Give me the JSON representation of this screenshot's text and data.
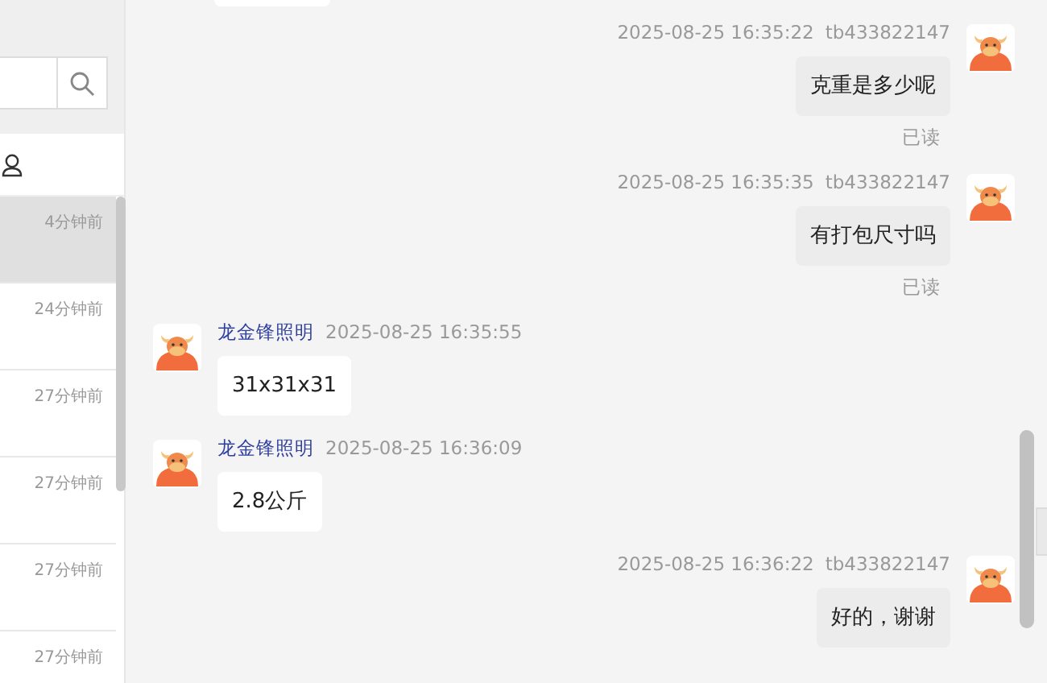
{
  "sidebar": {
    "conversations": [
      {
        "time": "4分钟前",
        "selected": true
      },
      {
        "time": "24分钟前",
        "selected": false
      },
      {
        "time": "27分钟前",
        "selected": false
      },
      {
        "time": "27分钟前",
        "selected": false
      },
      {
        "time": "27分钟前",
        "selected": false
      },
      {
        "time": "27分钟前",
        "selected": false
      }
    ]
  },
  "chat": {
    "messages": [
      {
        "kind": "sent",
        "time": "2025-08-25 16:35:22",
        "sender": "tb433822147",
        "text": "克重是多少呢",
        "status": "已读"
      },
      {
        "kind": "sent",
        "time": "2025-08-25 16:35:35",
        "sender": "tb433822147",
        "text": "有打包尺寸吗",
        "status": "已读"
      },
      {
        "kind": "received",
        "time": "2025-08-25 16:35:55",
        "sender": "龙金锋照明",
        "text": "31x31x31"
      },
      {
        "kind": "received",
        "time": "2025-08-25 16:36:09",
        "sender": "龙金锋照明",
        "text": "2.8公斤"
      },
      {
        "kind": "sent",
        "time": "2025-08-25 16:36:22",
        "sender": "tb433822147",
        "text": "好的，谢谢"
      }
    ]
  }
}
